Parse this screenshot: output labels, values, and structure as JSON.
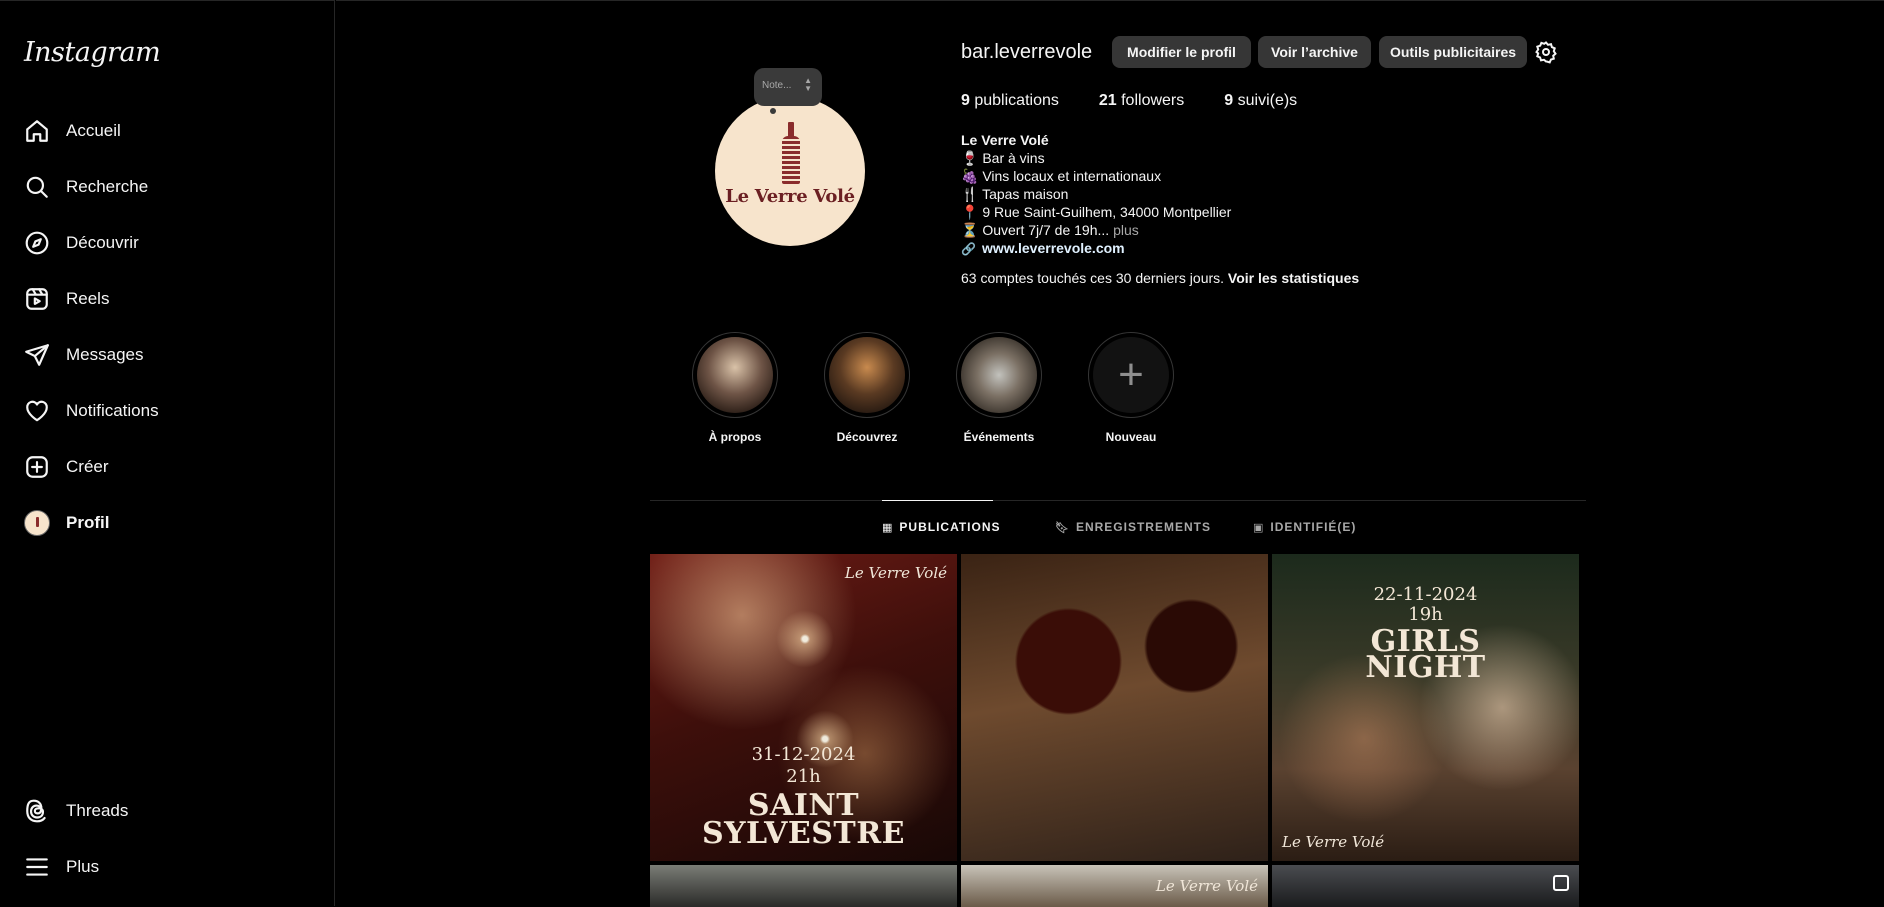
{
  "sidebar": {
    "logo": "Instagram",
    "items": [
      {
        "label": "Accueil",
        "icon": "home-icon"
      },
      {
        "label": "Recherche",
        "icon": "search-icon"
      },
      {
        "label": "Découvrir",
        "icon": "compass-icon"
      },
      {
        "label": "Reels",
        "icon": "reels-icon"
      },
      {
        "label": "Messages",
        "icon": "send-icon"
      },
      {
        "label": "Notifications",
        "icon": "heart-icon"
      },
      {
        "label": "Créer",
        "icon": "plus-square-icon"
      },
      {
        "label": "Profil",
        "icon": "avatar"
      }
    ],
    "bottom": [
      {
        "label": "Threads",
        "icon": "threads-icon"
      },
      {
        "label": "Plus",
        "icon": "menu-icon"
      }
    ]
  },
  "profile": {
    "note": "Note...",
    "avatar_text": "Le Verre Volé",
    "username": "bar.leverrevole",
    "buttons": {
      "edit": "Modifier le profil",
      "archive": "Voir l’archive",
      "ads": "Outils publicitaires"
    },
    "stats": {
      "posts_count": "9",
      "posts_label": "publications",
      "followers_count": "21",
      "followers_label": "followers",
      "following_count": "9",
      "following_label": "suivi(e)s"
    },
    "bio": {
      "name": "Le Verre Volé",
      "line1": "🍷 Bar à vins",
      "line2": "🍇 Vins locaux et internationaux",
      "line3": "🍴 Tapas maison",
      "line4": "📍 9 Rue Saint-Guilhem, 34000 Montpellier",
      "line5": "⏳ Ouvert 7j/7 de 19h...",
      "more": "plus",
      "link": "www.leverrevole.com"
    },
    "reach": {
      "text": "63 comptes touchés ces 30 derniers jours.",
      "link": "Voir les statistiques"
    }
  },
  "highlights": [
    {
      "label": "À propos"
    },
    {
      "label": "Découvrez"
    },
    {
      "label": "Événements"
    },
    {
      "label": "Nouveau"
    }
  ],
  "tabs": [
    {
      "label": "PUBLICATIONS",
      "active": true
    },
    {
      "label": "ENREGISTREMENTS",
      "active": false
    },
    {
      "label": "IDENTIFIÉ(E)",
      "active": false
    }
  ],
  "posts": [
    {
      "script": "Le Verre Volé",
      "date": "31-12-2024",
      "time": "21h",
      "title_1": "SAINT",
      "title_2": "SYLVESTRE"
    },
    {},
    {
      "date": "22-11-2024",
      "time": "19h",
      "title_1": "GIRLS",
      "title_2": "NIGHT",
      "script": "Le Verre Volé"
    },
    {},
    {
      "script": "Le Verre Volé"
    },
    {}
  ],
  "colors": {
    "background": "#000000",
    "button_bg": "#363636",
    "divider": "#262626",
    "avatar_bg": "#f7e4cc",
    "brand_red": "#6b1f22"
  }
}
